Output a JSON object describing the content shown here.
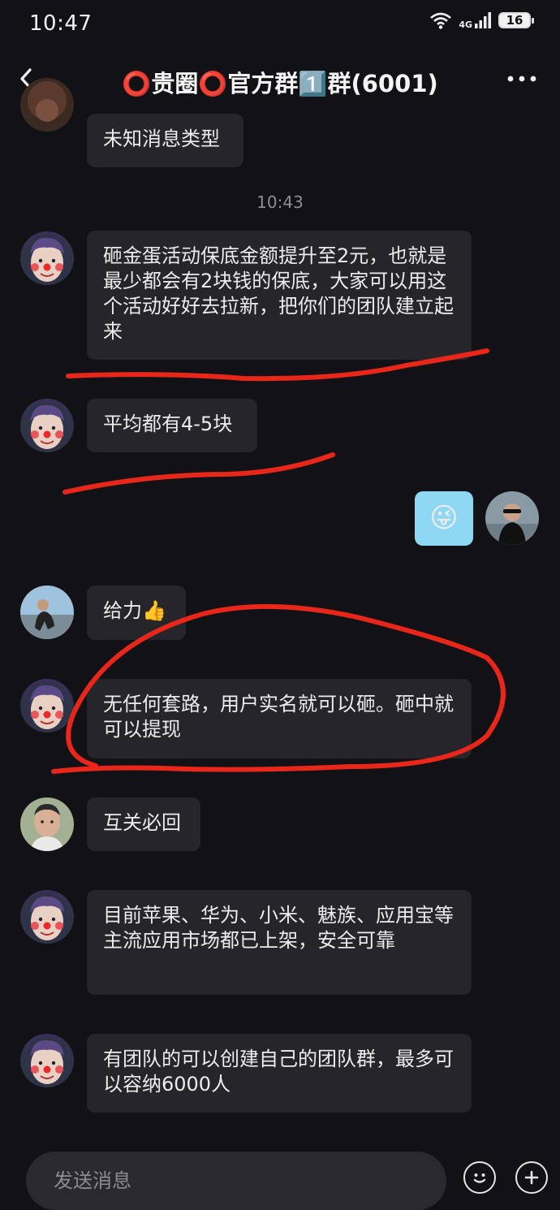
{
  "status_bar": {
    "time": "10:47",
    "network": "4G",
    "battery": "16"
  },
  "header": {
    "title": "⭕贵圈⭕官方群1️⃣群(6001)"
  },
  "messages": {
    "m0": "未知消息类型",
    "timestamp": "10:43",
    "m1": "砸金蛋活动保底金额提升至2元，也就是最少都会有2块钱的保底，大家可以用这个活动好好去拉新，把你们的团队建立起来",
    "m2": "平均都有4-5块",
    "m3_emoji": "😜",
    "m4": "给力👍",
    "m5": "无任何套路，用户实名就可以砸。砸中就可以提现",
    "m6": "互关必回",
    "m7": "目前苹果、华为、小米、魅族、应用宝等主流应用市场都已上架，安全可靠",
    "m8": "有团队的可以创建自己的团队群，最多可以容纳6000人"
  },
  "input": {
    "placeholder": "发送消息"
  },
  "colors": {
    "background": "#121216",
    "bubble": "#26262a",
    "sent_bubble": "#8fd8f4",
    "annotation": "#e8261a"
  }
}
